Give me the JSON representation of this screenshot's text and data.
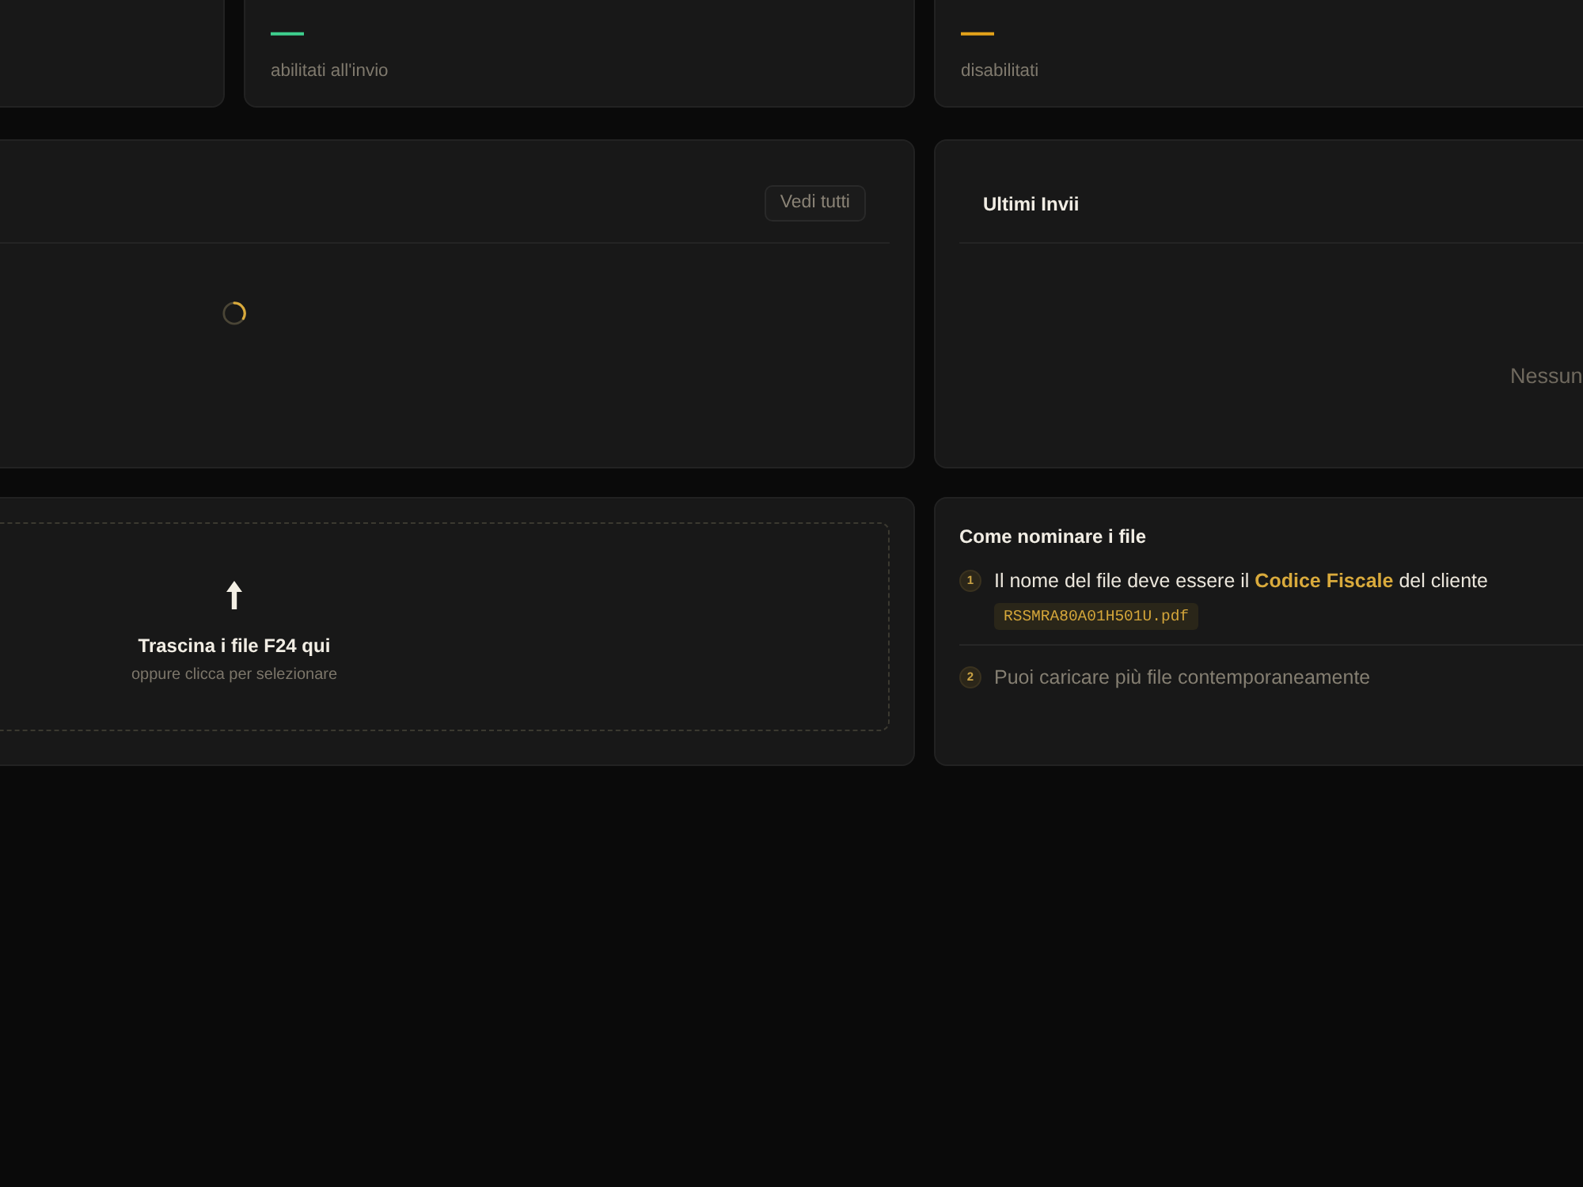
{
  "stats": [
    {
      "value": "—",
      "color": "#3ecf8e",
      "label": "abilitati all'invio"
    },
    {
      "value": "—",
      "color": "#e3a21a",
      "label": "disabilitati"
    }
  ],
  "recent_list": {
    "button": "Vedi tutti",
    "loading": true
  },
  "recent_sends": {
    "title": "Ultimi Invii",
    "empty_text": "Nessun"
  },
  "upload": {
    "title": "Trascina i file F24 qui",
    "subtitle": "oppure clicca per selezionare"
  },
  "naming_help": {
    "title": "Come nominare i file",
    "steps": [
      {
        "number": "1",
        "text": "Il nome del file deve essere il **Codice Fiscale** del cliente",
        "example": "RSSMRA80A01H501U.pdf",
        "dimmed": false
      },
      {
        "number": "2",
        "text": "Puoi caricare più file contemporaneamente",
        "dimmed": true
      }
    ]
  }
}
